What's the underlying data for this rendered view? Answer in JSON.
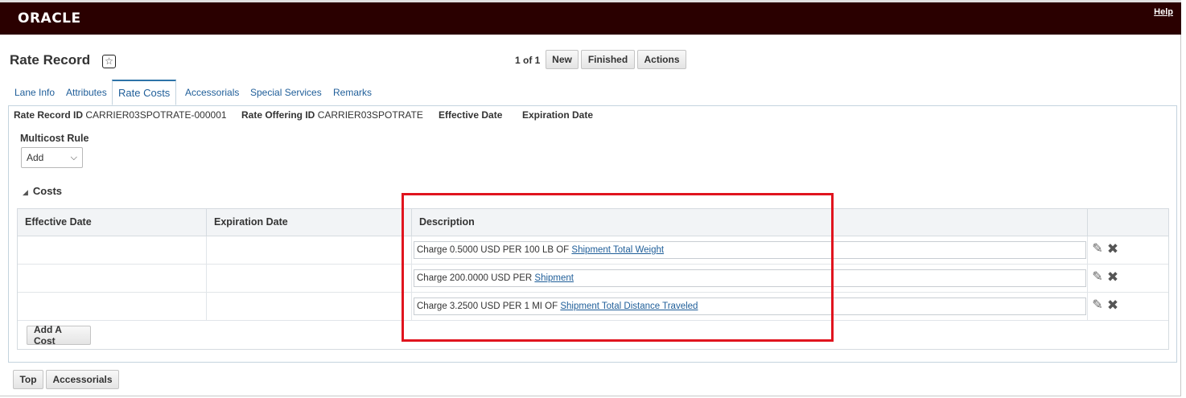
{
  "header": {
    "logo": "ORACLE",
    "help": "Help"
  },
  "page": {
    "title": "Rate Record",
    "pager": "1 of 1",
    "buttons": {
      "new": "New",
      "finished": "Finished",
      "actions": "Actions"
    }
  },
  "tabs": [
    "Lane Info",
    "Attributes",
    "Rate Costs",
    "Accessorials",
    "Special Services",
    "Remarks"
  ],
  "active_tab": "Rate Costs",
  "record": {
    "rate_record_id_label": "Rate Record ID",
    "rate_record_id": "CARRIER03SPOTRATE-000001",
    "rate_offering_id_label": "Rate Offering ID",
    "rate_offering_id": "CARRIER03SPOTRATE",
    "effective_date_label": "Effective Date",
    "expiration_date_label": "Expiration Date"
  },
  "multicost": {
    "label": "Multicost Rule",
    "value": "Add"
  },
  "costs": {
    "heading": "Costs",
    "columns": [
      "Effective Date",
      "Expiration Date",
      "Description"
    ],
    "rows": [
      {
        "prefix": "Charge 0.5000 USD PER 100 LB OF",
        "link": "Shipment Total Weight"
      },
      {
        "prefix": "Charge 200.0000 USD PER",
        "link": "Shipment"
      },
      {
        "prefix": "Charge 3.2500 USD PER 1 MI OF",
        "link": "Shipment Total Distance Traveled"
      }
    ],
    "add_button": "Add A Cost"
  },
  "footer": {
    "top": "Top",
    "accessorials": "Accessorials"
  },
  "colors": {
    "header_bg": "#2a0000",
    "link": "#1f5e99",
    "highlight": "#e0141e"
  },
  "icons": [
    "star-icon",
    "edit-icon",
    "delete-icon",
    "triangle-down-icon",
    "chevron-down-icon"
  ]
}
